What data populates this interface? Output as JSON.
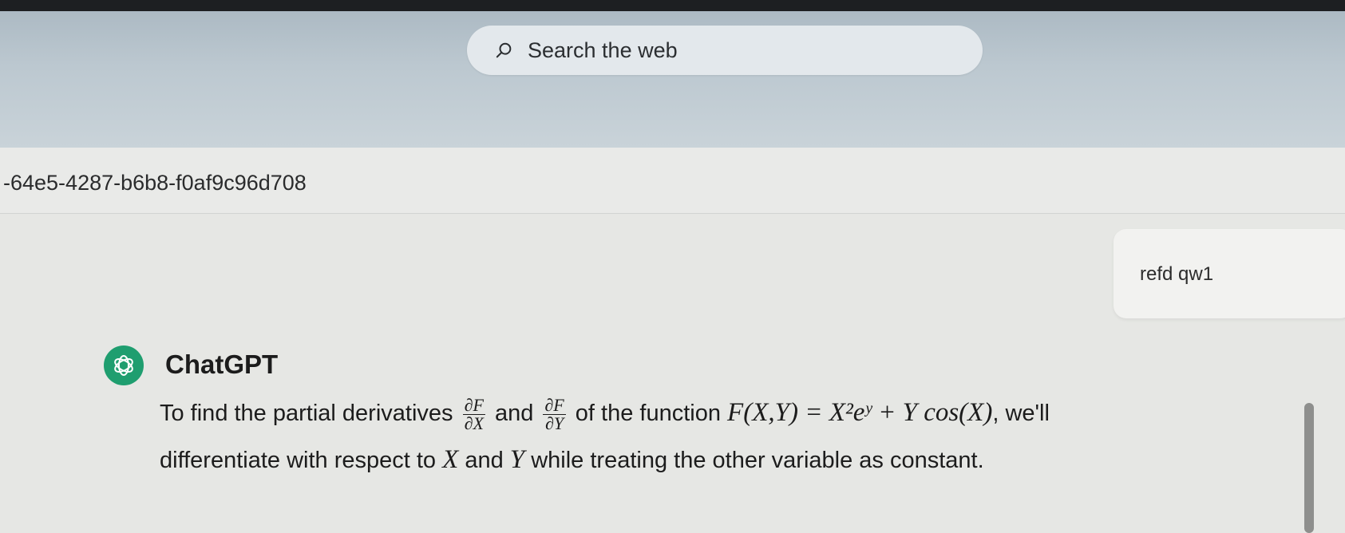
{
  "search": {
    "placeholder": "Search the web"
  },
  "url": {
    "text": "-64e5-4287-b6b8-f0af9c96d708"
  },
  "user_message": {
    "text": "refd qw1"
  },
  "assistant": {
    "name": "ChatGPT",
    "line1_part1": "To find the partial derivatives",
    "frac1_num": "∂F",
    "frac1_den": "∂X",
    "line1_and": "and",
    "frac2_num": "∂F",
    "frac2_den": "∂Y",
    "line1_part2": "of the function",
    "func": "F(X,Y) = X²eʸ + Y cos(X)",
    "line1_part3": ", we'll",
    "line2_part1": "differentiate with respect to",
    "var_x": "X",
    "line2_and": "and",
    "var_y": "Y",
    "line2_part2": "while treating the other variable as constant."
  },
  "colors": {
    "avatar": "#1f9e6f",
    "topbar": "#bcc8d0"
  }
}
